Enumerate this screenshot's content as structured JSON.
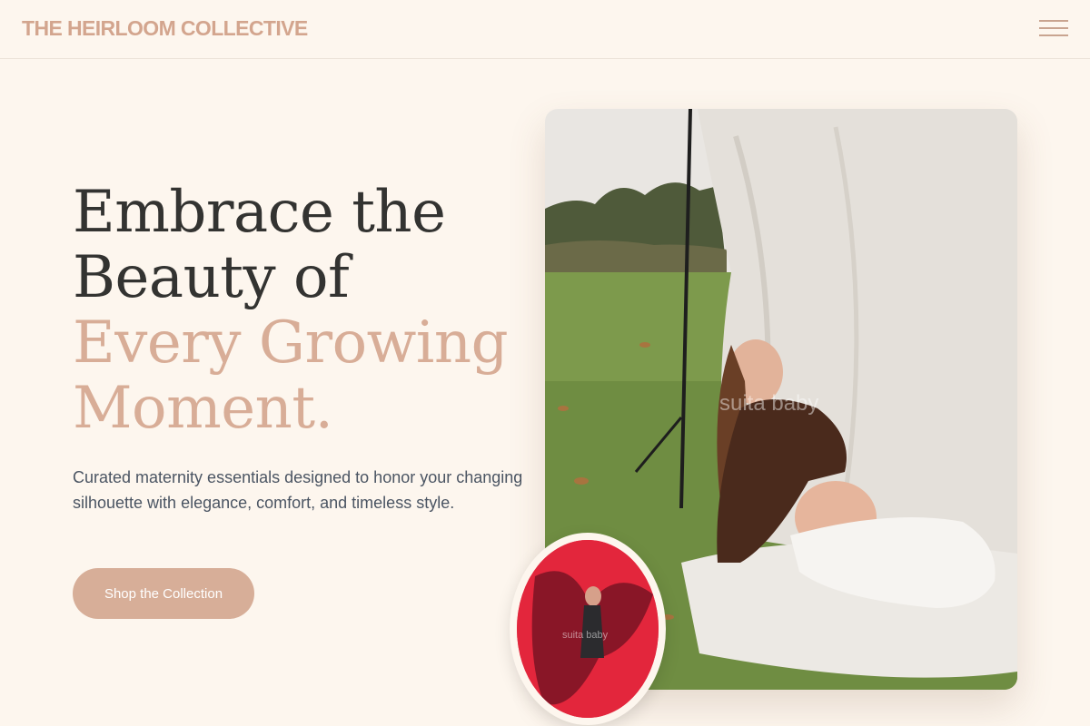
{
  "header": {
    "brand": "THE HEIRLOOM COLLECTIVE",
    "menu_icon": "hamburger-menu-icon"
  },
  "hero": {
    "title_line1": "Embrace the",
    "title_line2": "Beauty of",
    "title_accent1": "Every Growing",
    "title_accent2": "Moment.",
    "description": "Curated maternity essentials designed to honor your changing silhouette with elegance, comfort, and timeless style.",
    "cta_label": "Shop the Collection"
  },
  "images": {
    "main_watermark": "suita baby",
    "inset_watermark": "suita baby"
  },
  "colors": {
    "background": "#fdf6ee",
    "brand": "#d3a58e",
    "accent": "#d8ad97",
    "cta": "#d7ae98",
    "heading": "#333331",
    "body_text": "#4b5563"
  }
}
